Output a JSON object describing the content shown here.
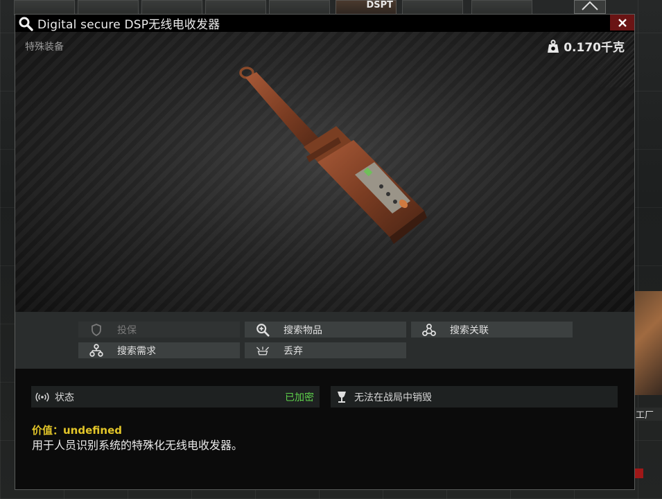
{
  "background": {
    "top_slot_label": "DSPT",
    "side_label": "工厂"
  },
  "window": {
    "title": "Digital secure DSP无线电收发器",
    "category": "特殊装备",
    "weight": "0.170千克",
    "close_icon": "close-icon"
  },
  "actions": {
    "insure": "投保",
    "search_item": "搜索物品",
    "search_linked": "搜索关联",
    "search_required": "搜索需求",
    "discard": "丢弃"
  },
  "info": {
    "status_label": "状态",
    "status_value": "已加密",
    "indestructible": "无法在战局中销毁"
  },
  "description": {
    "value_line": "价值：undefined",
    "text": "用于人员识别系统的特殊化无线电收发器。"
  },
  "colors": {
    "status_green": "#5fd34c",
    "value_yellow": "#e3c629",
    "close_red": "#6a1414"
  }
}
